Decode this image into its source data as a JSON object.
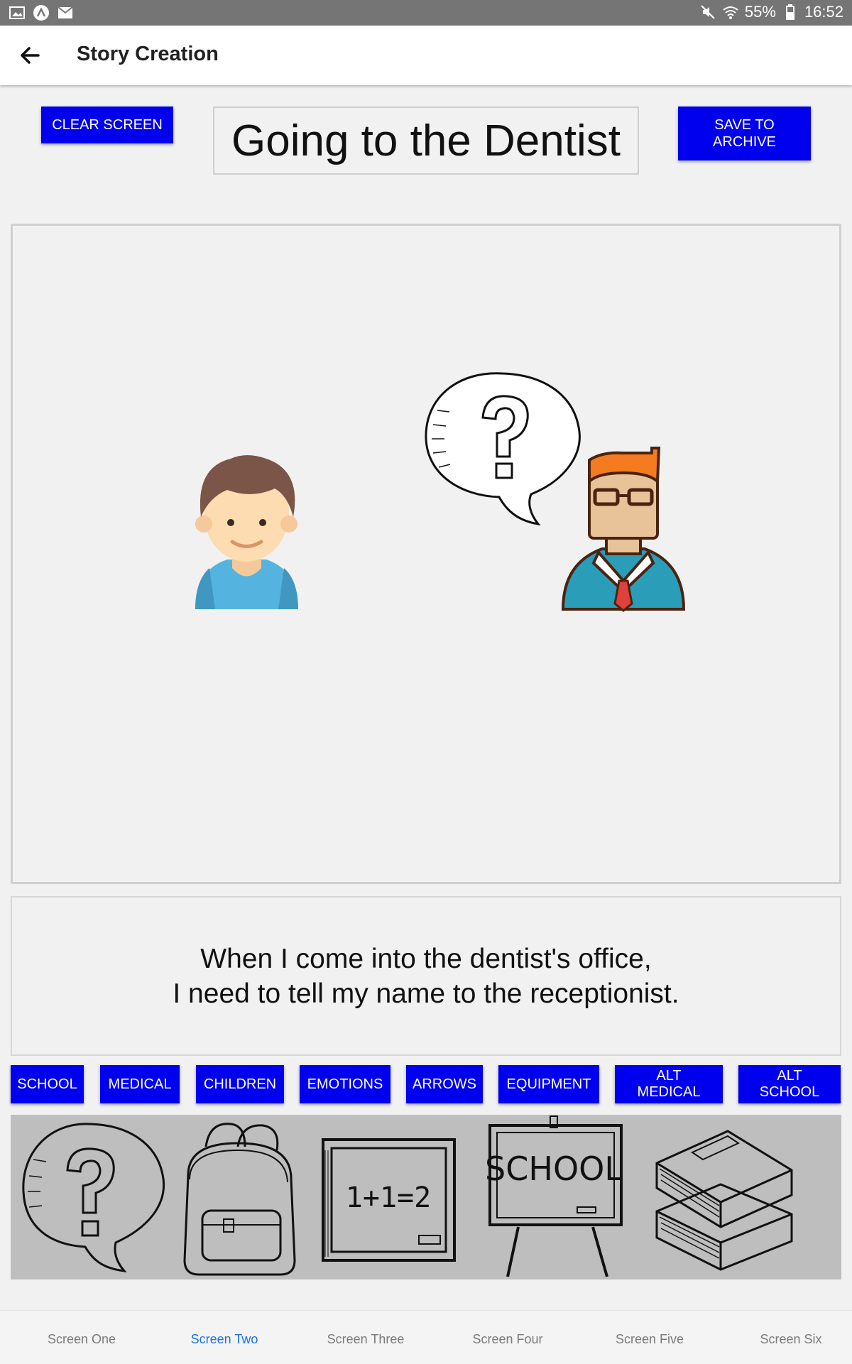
{
  "status_bar": {
    "battery": "55%",
    "time": "16:52",
    "icons": [
      "image-icon",
      "app-icon",
      "mail-icon",
      "mute-icon",
      "wifi-icon",
      "battery-icon"
    ]
  },
  "app_bar": {
    "title": "Story Creation",
    "back_icon": "back-arrow-icon"
  },
  "controls": {
    "clear_label": "CLEAR SCREEN",
    "save_label": "SAVE TO ARCHIVE",
    "story_title": "Going to the Dentist"
  },
  "canvas": {
    "items": [
      "boy-figure",
      "question-speech-bubble",
      "teacher-figure"
    ]
  },
  "caption": {
    "line1": "When I come into the dentist's office,",
    "line2": "I need to tell my name to the receptionist."
  },
  "categories": [
    "SCHOOL",
    "MEDICAL",
    "CHILDREN",
    "EMOTIONS",
    "ARROWS",
    "EQUIPMENT",
    "ALT MEDICAL",
    "ALT SCHOOL"
  ],
  "tray": {
    "school_board_text": "SCHOOL",
    "chalkboard_text": "1+1=2"
  },
  "bottom_nav": {
    "tabs": [
      "Screen One",
      "Screen Two",
      "Screen Three",
      "Screen Four",
      "Screen Five",
      "Screen Six"
    ],
    "active": "Screen Two"
  },
  "colors": {
    "button": "#0000ee",
    "active_tab": "#1a73e8",
    "background": "#f1f1f1",
    "tray": "#bebebe"
  }
}
